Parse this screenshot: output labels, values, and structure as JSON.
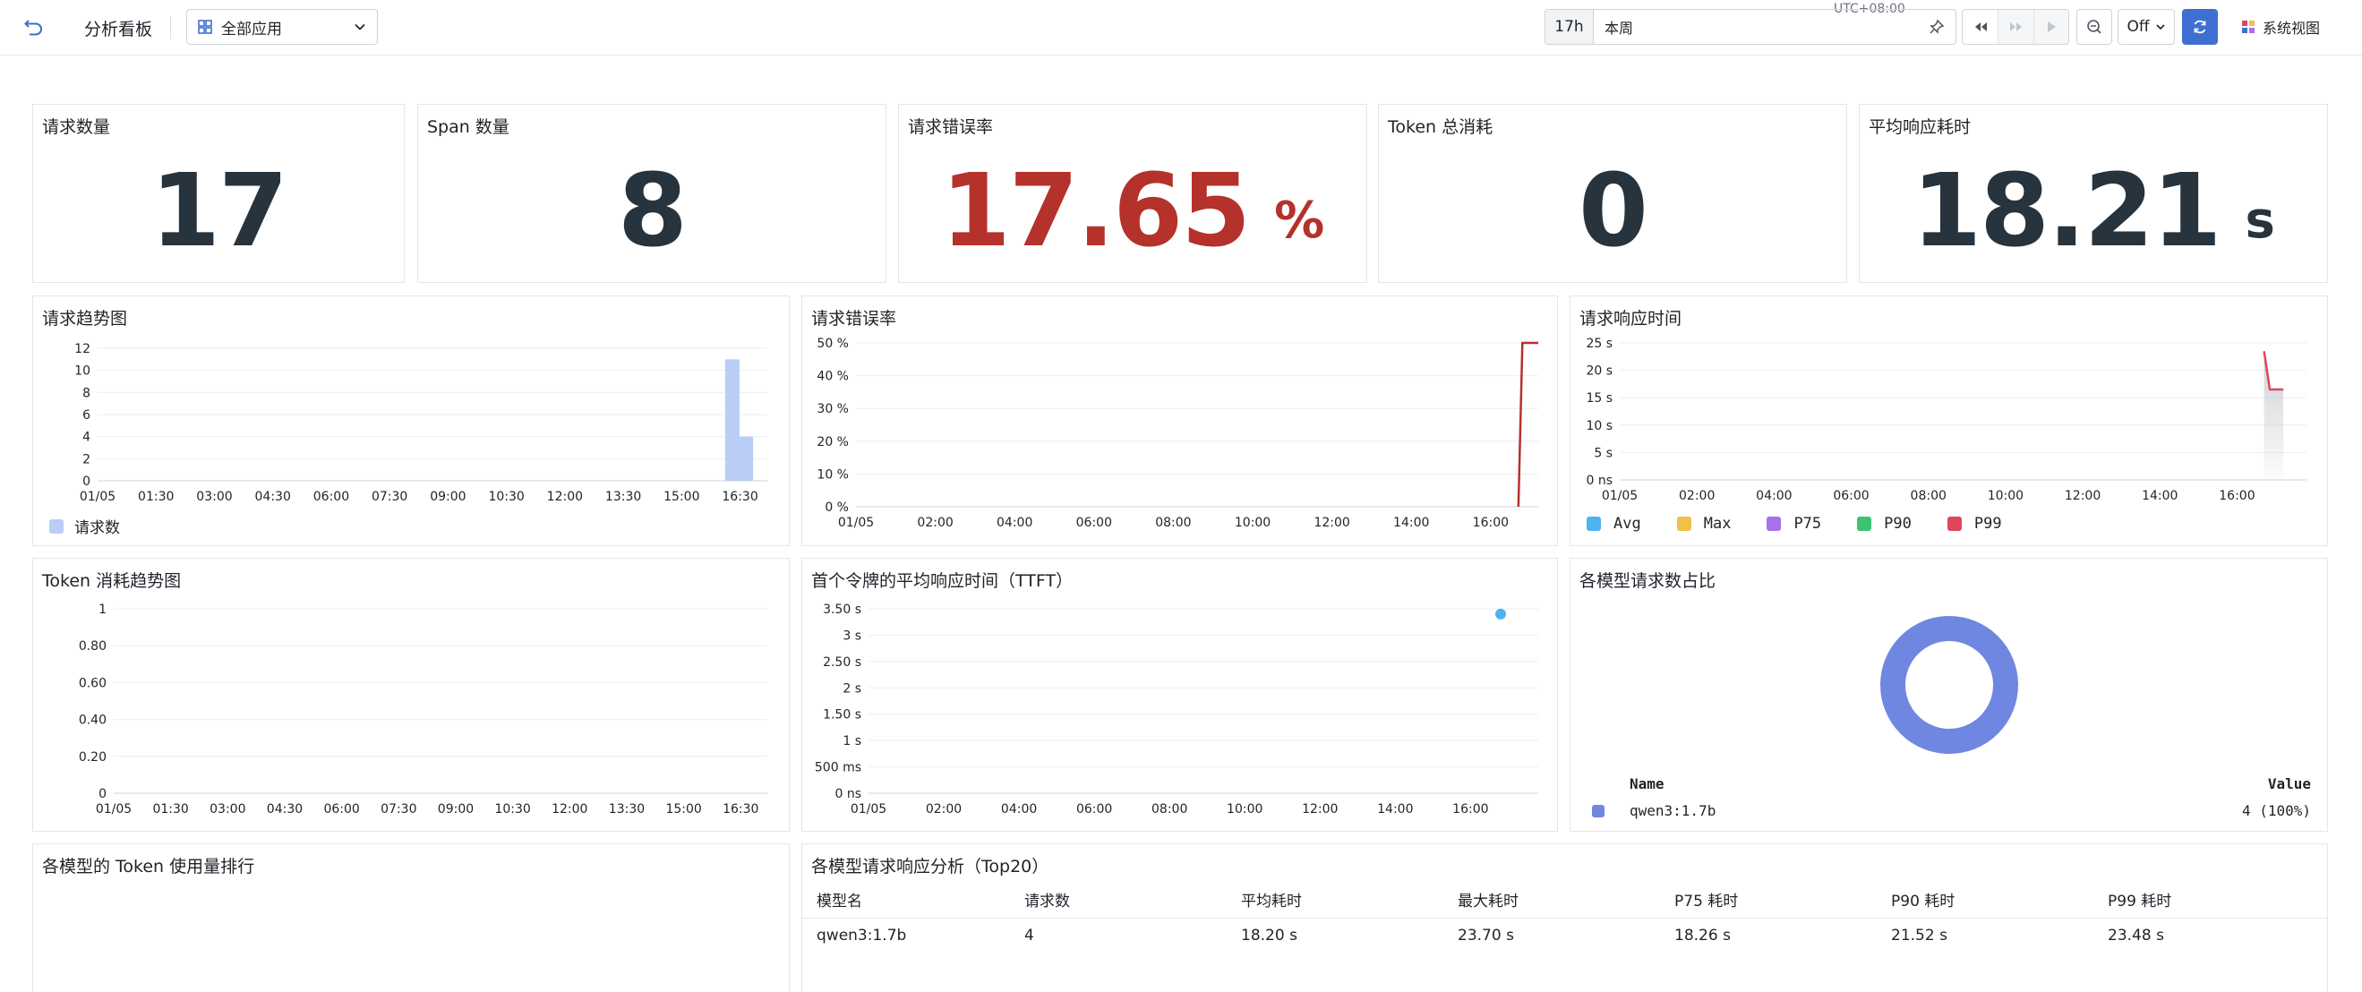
{
  "header": {
    "title": "分析看板",
    "app_select": "全部应用",
    "time_duration": "17h",
    "time_range": "本周",
    "timezone": "UTC+08:00",
    "refresh_interval": "Off",
    "system_view": "系统视图"
  },
  "stats": {
    "request_count": {
      "title": "请求数量",
      "value": "17"
    },
    "span_count": {
      "title": "Span 数量",
      "value": "8"
    },
    "error_rate": {
      "title": "请求错误率",
      "value": "17.65",
      "unit": "%",
      "color": "#b5312b"
    },
    "token_total": {
      "title": "Token 总消耗",
      "value": "0"
    },
    "avg_latency": {
      "title": "平均响应耗时",
      "value": "18.21",
      "unit": "s"
    }
  },
  "chart_data": [
    {
      "id": "request_trend",
      "type": "bar",
      "title": "请求趋势图",
      "x_ticks": [
        "01/05",
        "01:30",
        "03:00",
        "04:30",
        "06:00",
        "07:30",
        "09:00",
        "10:30",
        "12:00",
        "13:30",
        "15:00",
        "16:30"
      ],
      "y_ticks": [
        "0",
        "2",
        "4",
        "6",
        "8",
        "10",
        "12"
      ],
      "ylim": [
        0,
        12
      ],
      "series": [
        {
          "name": "请求数",
          "color": "#b9cdf6",
          "points": [
            {
              "x_hours": 16.3,
              "y": 11
            },
            {
              "x_hours": 16.65,
              "y": 4
            }
          ]
        }
      ],
      "x_range_hours": [
        0,
        17.2
      ],
      "legend_position": "bottom-left",
      "grid": true
    },
    {
      "id": "error_rate_trend",
      "type": "line",
      "title": "请求错误率",
      "x_ticks": [
        "01/05",
        "02:00",
        "04:00",
        "06:00",
        "08:00",
        "10:00",
        "12:00",
        "14:00",
        "16:00"
      ],
      "y_ticks": [
        "0 %",
        "10 %",
        "20 %",
        "30 %",
        "40 %",
        "50 %"
      ],
      "ylim": [
        0,
        50
      ],
      "series": [
        {
          "name": "错误率",
          "color": "#b5312b",
          "points": [
            {
              "x_hours": 16.7,
              "y": 0
            },
            {
              "x_hours": 16.8,
              "y": 50
            },
            {
              "x_hours": 17.2,
              "y": 50
            }
          ]
        }
      ],
      "x_range_hours": [
        0,
        17.2
      ],
      "grid": true
    },
    {
      "id": "latency_trend",
      "type": "area",
      "title": "请求响应时间",
      "x_ticks": [
        "01/05",
        "02:00",
        "04:00",
        "06:00",
        "08:00",
        "10:00",
        "12:00",
        "14:00",
        "16:00"
      ],
      "y_ticks": [
        "0 ns",
        "5 s",
        "10 s",
        "15 s",
        "20 s",
        "25 s"
      ],
      "ylim": [
        0,
        25
      ],
      "series": [
        {
          "name": "Avg",
          "color": "#4fb3f0",
          "points": []
        },
        {
          "name": "Max",
          "color": "#f0c048",
          "points": []
        },
        {
          "name": "P75",
          "color": "#a970e8",
          "points": []
        },
        {
          "name": "P90",
          "color": "#3dc373",
          "points": []
        },
        {
          "name": "P99",
          "color": "#e0455e",
          "points": [
            {
              "x_hours": 16.7,
              "y": 23.48
            },
            {
              "x_hours": 16.85,
              "y": 16.5
            },
            {
              "x_hours": 17.2,
              "y": 16.5
            }
          ]
        }
      ],
      "x_range_hours": [
        0,
        17.8
      ],
      "legend_position": "bottom",
      "grid": true
    },
    {
      "id": "token_trend",
      "type": "line",
      "title": "Token 消耗趋势图",
      "x_ticks": [
        "01/05",
        "01:30",
        "03:00",
        "04:30",
        "06:00",
        "07:30",
        "09:00",
        "10:30",
        "12:00",
        "13:30",
        "15:00",
        "16:30"
      ],
      "y_ticks": [
        "0",
        "0.20",
        "0.40",
        "0.60",
        "0.80",
        "1"
      ],
      "ylim": [
        0,
        1
      ],
      "series": [],
      "x_range_hours": [
        0,
        17.2
      ],
      "grid": true
    },
    {
      "id": "ttft_trend",
      "type": "scatter",
      "title": "首个令牌的平均响应时间（TTFT）",
      "x_ticks": [
        "01/05",
        "02:00",
        "04:00",
        "06:00",
        "08:00",
        "10:00",
        "12:00",
        "14:00",
        "16:00"
      ],
      "y_ticks": [
        "0 ns",
        "500 ms",
        "1 s",
        "1.50 s",
        "2 s",
        "2.50 s",
        "3 s",
        "3.50 s"
      ],
      "ylim": [
        0,
        3.5
      ],
      "series": [
        {
          "name": "TTFT",
          "color": "#4fb3f0",
          "points": [
            {
              "x_hours": 16.8,
              "y": 3.4
            }
          ]
        }
      ],
      "x_range_hours": [
        0,
        17.8
      ],
      "grid": true
    },
    {
      "id": "model_share",
      "type": "pie",
      "title": "各模型请求数占比",
      "slices": [
        {
          "name": "qwen3:1.7b",
          "value": 4,
          "label": "4 (100%)",
          "color": "#6f87e0"
        }
      ],
      "legend_headers": {
        "name": "Name",
        "value": "Value"
      }
    }
  ],
  "token_rank": {
    "title": "各模型的 Token 使用量排行"
  },
  "latency_table": {
    "title": "各模型请求响应分析（Top20）",
    "columns": [
      "模型名",
      "请求数",
      "平均耗时",
      "最大耗时",
      "P75 耗时",
      "P90 耗时",
      "P99 耗时"
    ],
    "rows": [
      [
        "qwen3:1.7b",
        "4",
        "18.20 s",
        "23.70 s",
        "18.26 s",
        "21.52 s",
        "23.48 s"
      ]
    ]
  }
}
